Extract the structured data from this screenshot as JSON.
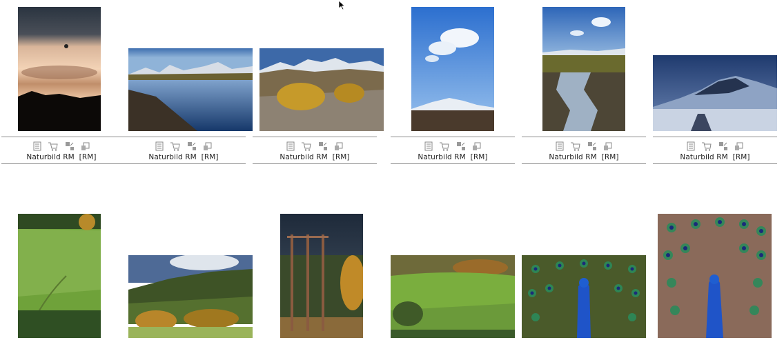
{
  "gallery": {
    "row1": [
      {
        "thumb_name": "sunset-balloon-photo",
        "caption": "Naturbild RM  [RM]"
      },
      {
        "thumb_name": "mountain-lake-photo",
        "caption": "Naturbild RM  [RM]"
      },
      {
        "thumb_name": "autumn-mountain-photo",
        "caption": "Naturbild RM  [RM]"
      },
      {
        "thumb_name": "snowy-peak-sky-photo",
        "caption": "Naturbild RM  [RM]"
      },
      {
        "thumb_name": "mountain-stream-photo",
        "caption": "Naturbild RM  [RM]"
      },
      {
        "thumb_name": "winter-mountains-photo",
        "caption": "Naturbild RM  [RM]"
      }
    ],
    "row2": [
      {
        "thumb_name": "green-field-forest-photo"
      },
      {
        "thumb_name": "valley-hills-photo"
      },
      {
        "thumb_name": "power-line-poles-photo"
      },
      {
        "thumb_name": "green-hill-field-photo"
      },
      {
        "thumb_name": "peacock-photo"
      },
      {
        "thumb_name": "peacock-portrait-photo"
      }
    ],
    "icons": [
      "info-icon",
      "cart-icon",
      "resize-icon",
      "lightbox-icon"
    ]
  }
}
